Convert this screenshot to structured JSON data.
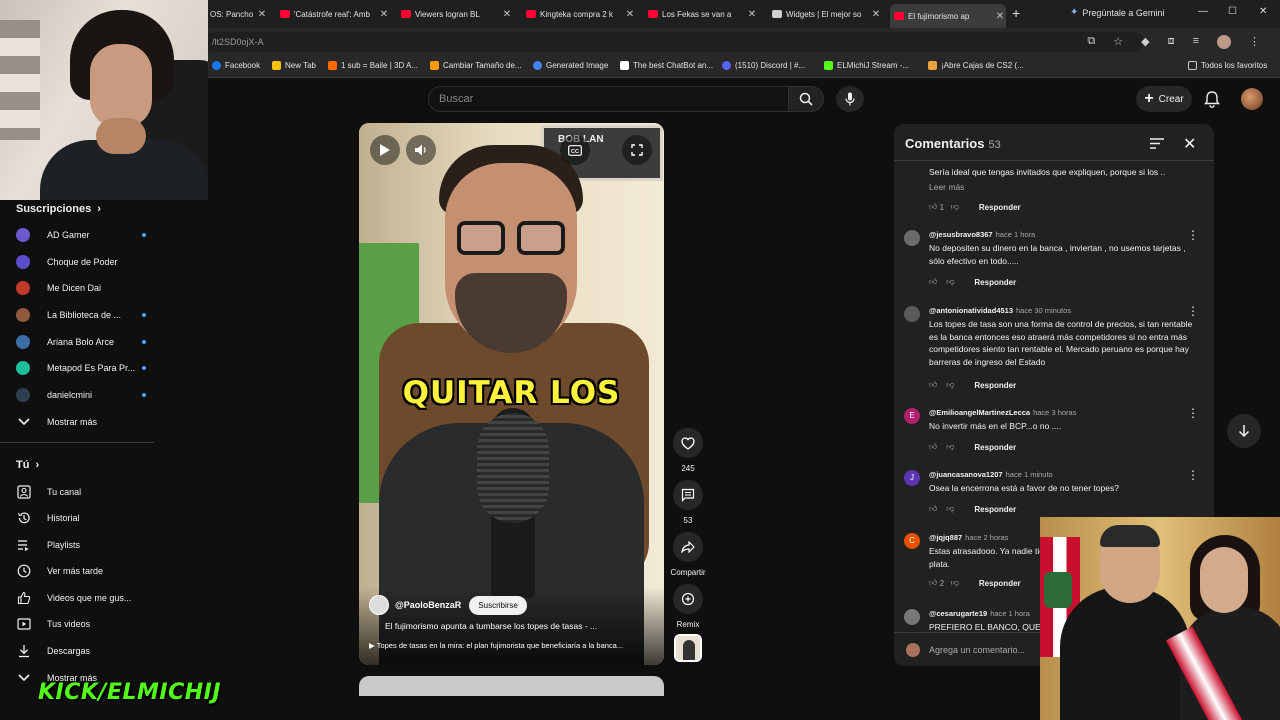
{
  "browser": {
    "tabs": [
      {
        "title": "OS: Pancho"
      },
      {
        "title": "'Catástrofe real': Amb"
      },
      {
        "title": "Viewers logran BL"
      },
      {
        "title": "Kingteka compra 2 k"
      },
      {
        "title": "Los Fekas se van a"
      },
      {
        "title": "Widgets | El mejor so"
      },
      {
        "title": "El fujimorismo ap"
      }
    ],
    "new_tab": "+",
    "gemini": "Pregúntale a Gemini",
    "url": "/lt2SD0ojX-A",
    "bookmarks": [
      {
        "label": "Facebook",
        "color": "#1877f2"
      },
      {
        "label": "New Tab",
        "color": "#f4c20d"
      },
      {
        "label": "1 sub = Baile | 3D A...",
        "color": "#ff6a00"
      },
      {
        "label": "Cambiar Tamaño de...",
        "color": "#ff9800"
      },
      {
        "label": "Generated Image",
        "color": "#4285f4"
      },
      {
        "label": "The best ChatBot an...",
        "color": "#ffffff"
      },
      {
        "label": "(1510) Discord | #...",
        "color": "#5865f2"
      },
      {
        "label": "ELMichiJ Stream -...",
        "color": "#53fc18"
      },
      {
        "label": "¡Abre Cajas de CS2 (...",
        "color": "#e6a23c"
      }
    ],
    "all_bookmarks": "Todos los favoritos"
  },
  "header": {
    "search_placeholder": "Buscar",
    "create_label": "Crear"
  },
  "sidebar": {
    "subscriptions_title": "Suscripciones",
    "channels": [
      {
        "name": "AD Gamer",
        "color": "#6a5acd",
        "dot": true
      },
      {
        "name": "Choque de Poder",
        "color": "#5b4fc9",
        "dot": false
      },
      {
        "name": "Me Dicen Dai",
        "color": "#c0392b",
        "dot": false
      },
      {
        "name": "La Biblioteca de ...",
        "color": "#8e5a3c",
        "dot": true
      },
      {
        "name": "Ariana Bolo Arce",
        "color": "#3a6ea5",
        "dot": true
      },
      {
        "name": "Metapod Es Para Pr...",
        "color": "#1abc9c",
        "dot": true
      },
      {
        "name": "danielcmini",
        "color": "#2c3e50",
        "dot": true
      }
    ],
    "show_more": "Mostrar más",
    "you_title": "Tú",
    "you_items": [
      {
        "label": "Tu canal",
        "icon": "channel-icon"
      },
      {
        "label": "Historial",
        "icon": "history-icon"
      },
      {
        "label": "Playlists",
        "icon": "playlists-icon"
      },
      {
        "label": "Ver más tarde",
        "icon": "watch-later-icon"
      },
      {
        "label": "Videos que me gus...",
        "icon": "liked-icon"
      },
      {
        "label": "Tus videos",
        "icon": "your-videos-icon"
      },
      {
        "label": "Descargas",
        "icon": "downloads-icon"
      }
    ],
    "show_more_2": "Mostrar más"
  },
  "overlay": {
    "kick_text": "KICK/ELMICHIJ"
  },
  "short": {
    "caption": "QUITAR LOS",
    "frame_text": "BOB LAN",
    "channel": "@PaoloBenzaR",
    "subscribe": "Suscribirse",
    "title": "El fujimorismo apunta a tumbarse los topes de tasas - ...",
    "related": "Topes de tasas en la mira: el plan fujimorista que beneficiaría a la banca...",
    "likes": "245",
    "comments": "53",
    "share": "Compartir",
    "remix": "Remix"
  },
  "comments": {
    "title": "Comentarios",
    "count": "53",
    "reply": "Responder",
    "read_more": "Leer más",
    "add_placeholder": "Agrega un comentario...",
    "first_partial": {
      "text": "Sería ideal que tengas invitados que expliquen, porque si los ..",
      "likes": "1"
    },
    "items": [
      {
        "author": "@jesusbravo8367",
        "time": "hace 1 hora",
        "text": "No depositen su dinero en la banca , inviertan , no usemos tarjetas , sólo efectivo en todo.....",
        "likes": "",
        "avatar": "#6b6b6b",
        "initial": ""
      },
      {
        "author": "@antonionatividad4513",
        "time": "hace 30 minutos",
        "text": "Los topes de tasa son una forma de control de precios, si tan rentable es la banca entonces eso atraerá más competidores si no entra más competidores siento tan rentable el. Mercado peruano es porque hay barreras de ingreso del Estado",
        "likes": "",
        "avatar": "#5a5a5a",
        "initial": ""
      },
      {
        "author": "@EmilioangelMartinezLecca",
        "time": "hace 3 horas",
        "text": "No invertir más en el BCP...o no ....",
        "likes": "",
        "avatar": "#b0206e",
        "initial": "E"
      },
      {
        "author": "@juancasanova1207",
        "time": "hace 1 minuto",
        "text": "Osea la encerrona está a favor de no tener topes?",
        "likes": "",
        "avatar": "#5e35b1",
        "initial": "J"
      },
      {
        "author": "@jqjq887",
        "time": "hace 2 horas",
        "text": "Estas atrasadooo. Ya nadie tienen plata.",
        "likes": "2",
        "avatar": "#e65100",
        "initial": "C"
      },
      {
        "author": "@cesarugarte19",
        "time": "hace 1 hora",
        "text": "PREFIERO EL BANCO, QUE",
        "likes": "",
        "avatar": "#777777",
        "initial": ""
      }
    ]
  }
}
